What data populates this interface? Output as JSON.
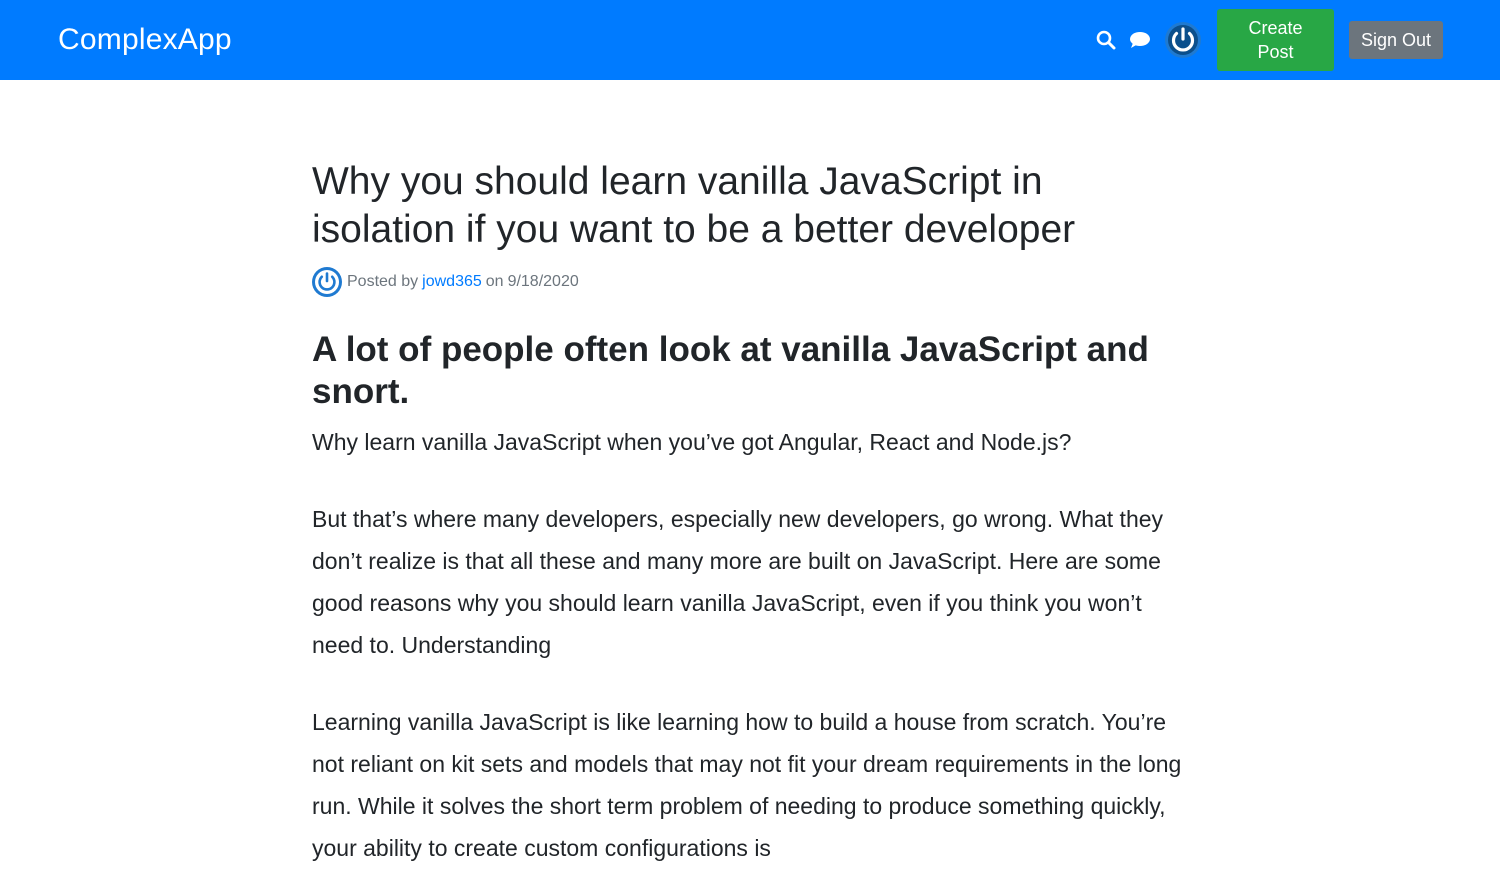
{
  "header": {
    "brand": "ComplexApp",
    "icons": {
      "search": "search-icon",
      "chat": "chat-icon",
      "avatar": "avatar-power-icon"
    },
    "create_post_label": "Create Post",
    "sign_out_label": "Sign Out",
    "colors": {
      "header_bg": "#007bff",
      "create_post_bg": "#28a745",
      "sign_out_bg": "#6c757d",
      "avatar_blue": "#1f7ad1"
    }
  },
  "post": {
    "title": "Why you should learn vanilla JavaScript in isolation if you want to be a better developer",
    "meta": {
      "posted_by": "Posted by",
      "author": "jowd365",
      "on": "on",
      "date": "9/18/2020"
    },
    "heading": "A lot of people often look at vanilla JavaScript and snort.",
    "paragraphs": [
      "Why learn vanilla JavaScript when you’ve got Angular, React and Node.js?",
      "But that’s where many developers, especially new developers, go wrong. What they don’t realize is that all these and many more are built on JavaScript. Here are some good reasons why you should learn vanilla JavaScript, even if you think you won’t need to. Understanding",
      "Learning vanilla JavaScript is like learning how to build a house from scratch. You’re not reliant on kit sets and models that may not fit your dream requirements in the long run. While it solves the short term problem of needing to produce something quickly, your ability to create custom configurations is"
    ]
  }
}
